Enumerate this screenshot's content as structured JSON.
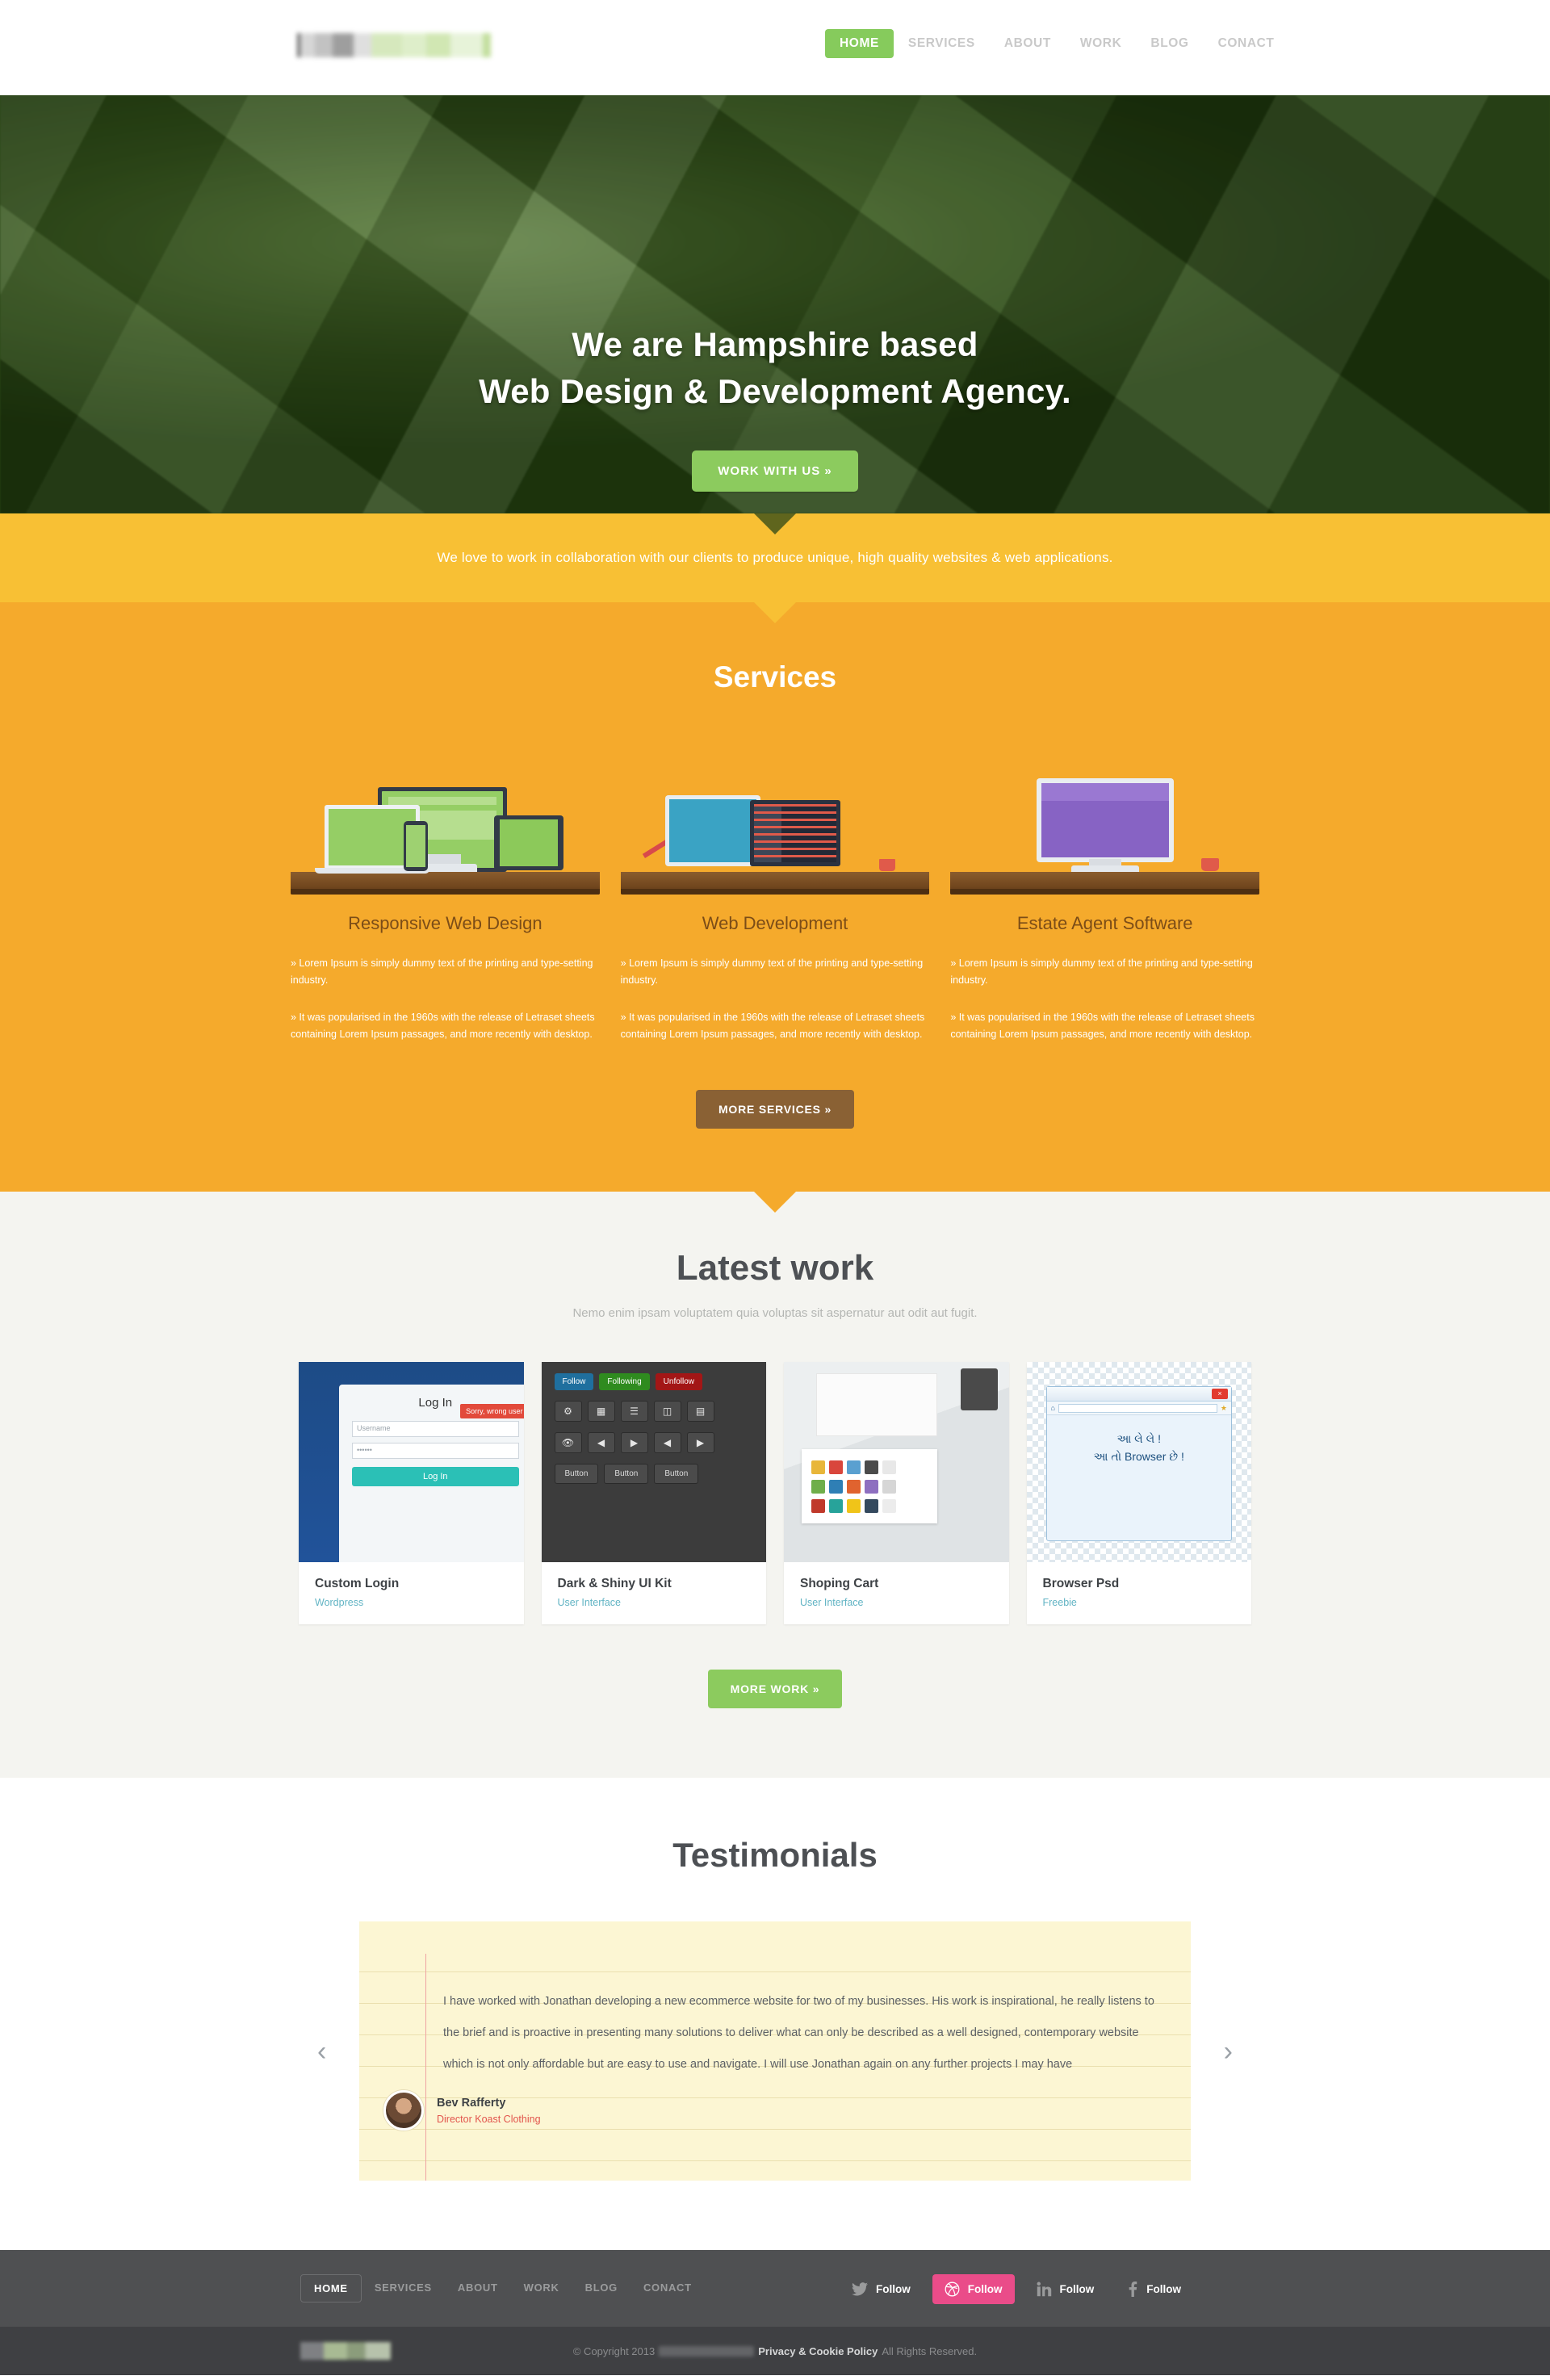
{
  "header": {
    "logo_alt": "company-logo",
    "nav": [
      {
        "label": "HOME",
        "active": true
      },
      {
        "label": "SERVICES",
        "active": false
      },
      {
        "label": "ABOUT",
        "active": false
      },
      {
        "label": "WORK",
        "active": false
      },
      {
        "label": "BLOG",
        "active": false
      },
      {
        "label": "CONACT",
        "active": false
      }
    ]
  },
  "hero": {
    "line1": "We are Hampshire based",
    "line2": "Web Design & Development Agency.",
    "cta": "WORK WITH US »"
  },
  "band": {
    "text": "We love to work in collaboration with our clients to produce unique, high quality websites & web applications."
  },
  "services": {
    "heading": "Services",
    "items": [
      {
        "title": "Responsive Web Design",
        "p1": "» Lorem Ipsum is simply dummy text of the printing and type-setting industry.",
        "p2": "» It was popularised in the 1960s with the release of Letraset sheets containing Lorem Ipsum passages, and more recently with desktop.",
        "illustration": "responsive-devices-illustration"
      },
      {
        "title": "Web Development",
        "p1": "» Lorem Ipsum is simply dummy text of the printing and type-setting industry.",
        "p2": "» It was popularised in the 1960s with the release of Letraset sheets containing Lorem Ipsum passages, and more recently with desktop.",
        "illustration": "developer-desk-illustration"
      },
      {
        "title": "Estate Agent Software",
        "p1": "» Lorem Ipsum is simply dummy text of the printing and type-setting industry.",
        "p2": "» It was popularised in the 1960s with the release of Letraset sheets containing Lorem Ipsum passages, and more recently with desktop.",
        "illustration": "estate-software-illustration"
      }
    ],
    "more_button": "MORE SERVICES »"
  },
  "work": {
    "heading": "Latest work",
    "subheading": "Nemo enim ipsam voluptatem quia voluptas sit aspernatur aut odit aut fugit.",
    "cards": [
      {
        "title": "Custom Login",
        "category": "Wordpress",
        "thumb": {
          "kind": "login-form-screenshot",
          "form_title": "Log In",
          "username_placeholder": "Username",
          "password_value": "••••••",
          "submit_label": "Log In",
          "error_text": "Sorry, wrong user"
        }
      },
      {
        "title": "Dark & Shiny UI Kit",
        "category": "User Interface",
        "thumb": {
          "kind": "dark-ui-kit-screenshot",
          "pills": [
            "Follow",
            "Following",
            "Unfollow"
          ],
          "buttons": [
            "Button",
            "Button",
            "Button"
          ]
        }
      },
      {
        "title": "Shoping Cart",
        "category": "User Interface",
        "thumb": {
          "kind": "shopping-cart-photo"
        }
      },
      {
        "title": "Browser Psd",
        "category": "Freebie",
        "thumb": {
          "kind": "browser-psd-screenshot",
          "text_line1": "આ લે લે !",
          "text_line2": "આ તો Browser છે !"
        }
      }
    ],
    "more_button": "MORE WORK »"
  },
  "testimonials": {
    "heading": "Testimonials",
    "quote": "I have worked with Jonathan developing a new ecommerce website for two of my businesses. His work is inspirational, he really listens to the brief and is proactive in presenting many solutions to deliver what can only be described as a well designed, contemporary website which is not only affordable but are easy to use and navigate. I will use Jonathan again on any further projects I may have",
    "author_name": "Bev Rafferty",
    "author_role": "Director Koast Clothing",
    "prev": "‹",
    "next": "›"
  },
  "footer": {
    "nav": [
      {
        "label": "HOME",
        "active": true
      },
      {
        "label": "SERVICES",
        "active": false
      },
      {
        "label": "ABOUT",
        "active": false
      },
      {
        "label": "WORK",
        "active": false
      },
      {
        "label": "BLOG",
        "active": false
      },
      {
        "label": "CONACT",
        "active": false
      }
    ],
    "social": [
      {
        "network": "twitter",
        "label": "Follow",
        "highlight": false
      },
      {
        "network": "dribbble",
        "label": "Follow",
        "highlight": true
      },
      {
        "network": "linkedin",
        "label": "Follow",
        "highlight": false
      },
      {
        "network": "facebook",
        "label": "Follow",
        "highlight": false
      }
    ],
    "copyright_prefix": "© Copyright  2013",
    "privacy_label": "Privacy & Cookie Policy",
    "copyright_suffix": "All Rights Reserved."
  },
  "colors": {
    "accent_green": "#8ccb5e",
    "band_yellow": "#f8c034",
    "services_orange": "#f5aa2c",
    "work_bg": "#f4f4f0",
    "testimonial_paper": "#fcf6d3",
    "footer_grey": "#4f5052",
    "copy_grey": "#3f4043",
    "link_teal": "#62b4c4",
    "dribbble_pink": "#ea4c89",
    "role_red": "#e2554d"
  }
}
